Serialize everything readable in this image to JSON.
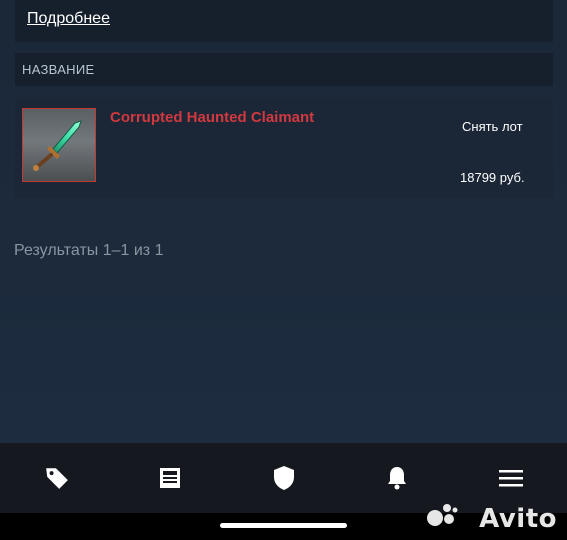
{
  "top_panel": {
    "more_link": "Подробнее"
  },
  "section": {
    "header": "НАЗВАНИЕ"
  },
  "listing": {
    "item_name": "Corrupted Haunted Claimant",
    "remove_label": "Снять лот",
    "price": "18799 руб.",
    "item_name_color": "#d2383f",
    "thumb_border_color": "#c43a30"
  },
  "results": "Результаты 1–1 из 1",
  "bottom_nav": {
    "items": [
      {
        "icon": "tag-icon"
      },
      {
        "icon": "news-icon"
      },
      {
        "icon": "shield-icon"
      },
      {
        "icon": "bell-icon"
      },
      {
        "icon": "menu-icon"
      }
    ]
  },
  "watermark": "Avito"
}
